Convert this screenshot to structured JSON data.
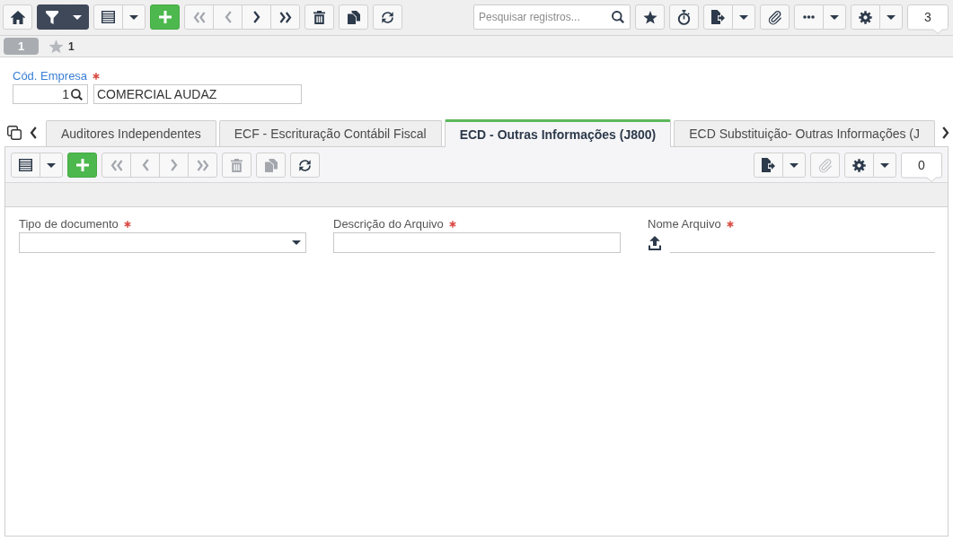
{
  "main_toolbar": {
    "left_groups": [
      {
        "on": false,
        "buttons": [
          {
            "kind": "home",
            "disabled": false
          }
        ]
      },
      {
        "on": true,
        "buttons": [
          {
            "kind": "filter",
            "disabled": false
          },
          {
            "kind": "menu",
            "disabled": false
          }
        ]
      },
      {
        "on": false,
        "buttons": [
          {
            "kind": "view",
            "disabled": false
          },
          {
            "kind": "menu",
            "disabled": false
          }
        ]
      },
      {
        "on": false,
        "buttons": [
          {
            "kind": "add",
            "disabled": false
          }
        ]
      },
      {
        "on": false,
        "buttons": [
          {
            "kind": "first",
            "disabled": true
          },
          {
            "kind": "previous",
            "disabled": true
          },
          {
            "kind": "next",
            "disabled": false
          },
          {
            "kind": "last",
            "disabled": false
          }
        ]
      },
      {
        "on": false,
        "buttons": [
          {
            "kind": "delete",
            "disabled": false
          }
        ]
      },
      {
        "on": false,
        "buttons": [
          {
            "kind": "copy",
            "disabled": false
          }
        ]
      },
      {
        "on": false,
        "buttons": [
          {
            "kind": "refresh",
            "disabled": false
          }
        ]
      }
    ],
    "search": {
      "placeholder": "Pesquisar registros..."
    },
    "right_groups": [
      {
        "on": false,
        "buttons": [
          {
            "kind": "favorite",
            "disabled": false
          }
        ]
      },
      {
        "on": false,
        "buttons": [
          {
            "kind": "timer",
            "disabled": false
          }
        ]
      },
      {
        "on": false,
        "buttons": [
          {
            "kind": "export",
            "disabled": false
          },
          {
            "kind": "menu",
            "disabled": false
          }
        ]
      },
      {
        "on": false,
        "buttons": [
          {
            "kind": "attach",
            "disabled": false
          }
        ]
      },
      {
        "on": false,
        "buttons": [
          {
            "kind": "more",
            "disabled": false
          },
          {
            "kind": "menu",
            "disabled": false
          }
        ]
      },
      {
        "on": false,
        "buttons": [
          {
            "kind": "settings",
            "disabled": false
          },
          {
            "kind": "menu",
            "disabled": false
          }
        ]
      }
    ],
    "record_count": "3"
  },
  "record_bar": {
    "record_tab": "1",
    "favorites_count": "1"
  },
  "company": {
    "label": "Cód. Empresa",
    "required": true,
    "code": "1",
    "name": "COMERCIAL AUDAZ"
  },
  "tabs": [
    {
      "label": "Auditores Independentes",
      "selected": false
    },
    {
      "label": "ECF - Escrituração Contábil Fiscal",
      "selected": false
    },
    {
      "label": "ECD - Outras Informações (J800)",
      "selected": true
    },
    {
      "label": "ECD Substituição- Outras Informações (J",
      "selected": false
    }
  ],
  "detail": {
    "toolbar": {
      "left_groups": [
        {
          "on": false,
          "buttons": [
            {
              "kind": "view",
              "disabled": false
            },
            {
              "kind": "menu",
              "disabled": false
            }
          ]
        },
        {
          "on": false,
          "buttons": [
            {
              "kind": "add",
              "disabled": false
            }
          ]
        },
        {
          "on": false,
          "buttons": [
            {
              "kind": "first",
              "disabled": true
            },
            {
              "kind": "previous",
              "disabled": true
            },
            {
              "kind": "next",
              "disabled": true
            },
            {
              "kind": "last",
              "disabled": true
            }
          ]
        },
        {
          "on": false,
          "buttons": [
            {
              "kind": "delete",
              "disabled": true
            }
          ]
        },
        {
          "on": false,
          "buttons": [
            {
              "kind": "copy",
              "disabled": true
            }
          ]
        },
        {
          "on": false,
          "buttons": [
            {
              "kind": "refresh",
              "disabled": false
            }
          ]
        }
      ],
      "right_groups": [
        {
          "on": false,
          "buttons": [
            {
              "kind": "export",
              "disabled": false
            },
            {
              "kind": "menu",
              "disabled": false
            }
          ]
        },
        {
          "on": false,
          "buttons": [
            {
              "kind": "attach",
              "disabled": true
            }
          ]
        },
        {
          "on": false,
          "buttons": [
            {
              "kind": "settings",
              "disabled": false
            },
            {
              "kind": "menu",
              "disabled": false
            }
          ]
        }
      ],
      "record_count": "0"
    },
    "fields": [
      {
        "kind": "select",
        "label": "Tipo de documento",
        "required": true
      },
      {
        "kind": "text",
        "label": "Descrição do Arquivo",
        "required": true
      },
      {
        "kind": "upload",
        "label": "Nome Arquivo",
        "required": true
      }
    ]
  }
}
